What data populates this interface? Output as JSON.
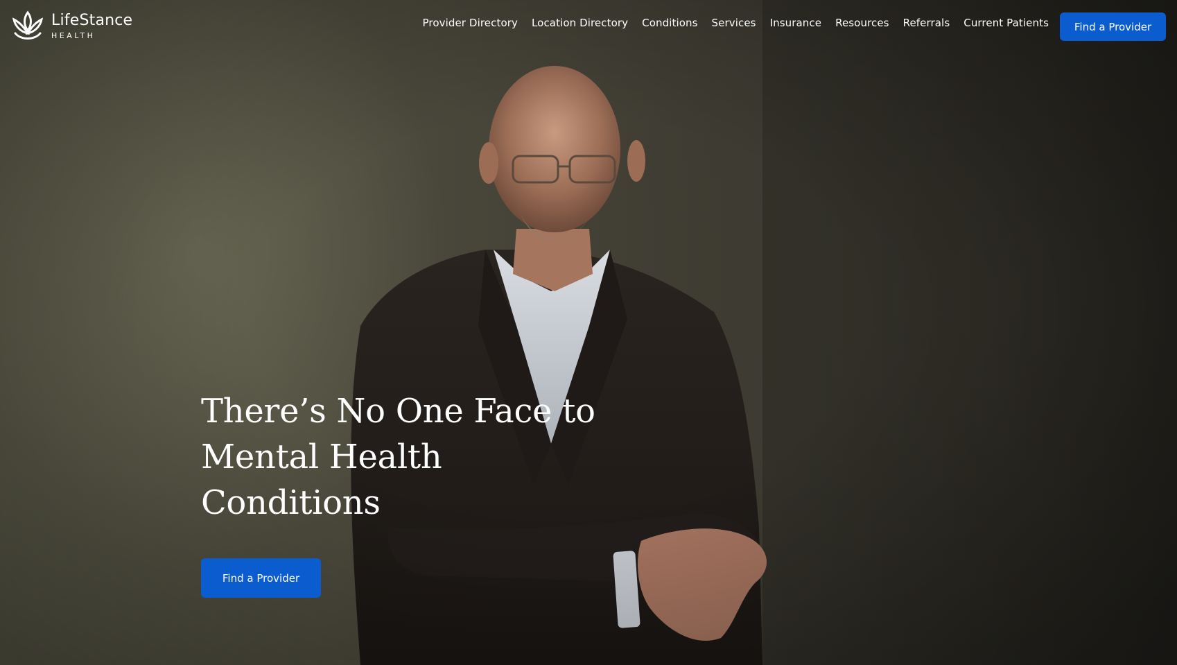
{
  "brand": {
    "name": "LifeStance",
    "subtitle": "HEALTH",
    "logo_icon": "lotus-hands-icon"
  },
  "nav": {
    "items": [
      {
        "label": "Provider Directory"
      },
      {
        "label": "Location Directory"
      },
      {
        "label": "Conditions"
      },
      {
        "label": "Services"
      },
      {
        "label": "Insurance"
      },
      {
        "label": "Resources"
      },
      {
        "label": "Referrals"
      },
      {
        "label": "Current Patients"
      }
    ],
    "cta_label": "Find a Provider"
  },
  "hero": {
    "title": "There’s No One Face to Mental Health Conditions",
    "cta_label": "Find a Provider",
    "image": "portrait of a man with glasses wearing a dark cardigan, arms crossed"
  },
  "colors": {
    "primary": "#0a5ccf",
    "text_on_dark": "#ffffff",
    "background": "#4a4839"
  }
}
